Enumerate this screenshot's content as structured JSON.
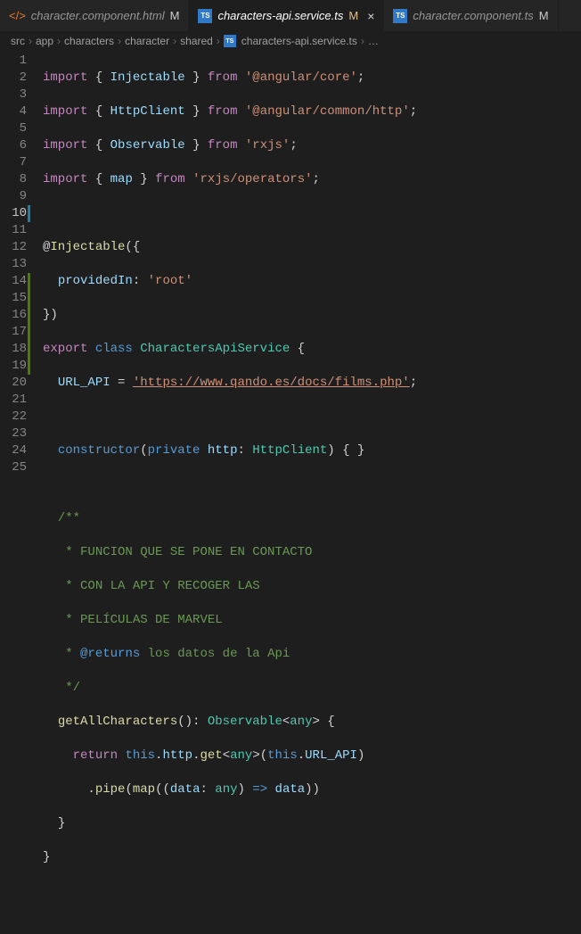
{
  "tabs": [
    {
      "icon": "html",
      "label": "character.component.html",
      "dirty": "M",
      "active": false
    },
    {
      "icon": "ts",
      "label": "characters-api.service.ts",
      "dirty": "M",
      "active": true
    },
    {
      "icon": "ts",
      "label": "character.component.ts",
      "dirty": "M",
      "active": false
    }
  ],
  "breadcrumbs": {
    "parts": [
      "src",
      "app",
      "characters",
      "character",
      "shared"
    ],
    "file_icon": "ts",
    "file": "characters-api.service.ts",
    "trailing": "…"
  },
  "gutter": {
    "highlight_line": 10,
    "decorations": {
      "10": "blue",
      "14": "green",
      "15": "green",
      "16": "green",
      "17": "green",
      "18": "green",
      "19": "green"
    },
    "count": 25
  },
  "code": {
    "l1": {
      "a": "import",
      "b": "Injectable",
      "c": "from",
      "d": "'@angular/core'"
    },
    "l2": {
      "a": "import",
      "b": "HttpClient",
      "c": "from",
      "d": "'@angular/common/http'"
    },
    "l3": {
      "a": "import",
      "b": "Observable",
      "c": "from",
      "d": "'rxjs'"
    },
    "l4": {
      "a": "import",
      "b": "map",
      "c": "from",
      "d": "'rxjs/operators'"
    },
    "l6": {
      "a": "@",
      "b": "Injectable",
      "c": "({"
    },
    "l7": {
      "a": "providedIn",
      "b": ": ",
      "c": "'root'"
    },
    "l8": {
      "a": "})"
    },
    "l9": {
      "a": "export",
      "b": "class",
      "c": "CharactersApiService",
      "d": " {"
    },
    "l10": {
      "a": "URL_API",
      "b": " = ",
      "c": "'https://www.qando.es/docs/films.php'",
      "d": ";"
    },
    "l12": {
      "a": "constructor",
      "b": "(",
      "c": "private",
      "d": "http",
      "e": ": ",
      "f": "HttpClient",
      "g": ") { }"
    },
    "l14": {
      "a": "/**"
    },
    "l15": {
      "a": " * FUNCION QUE SE PONE EN CONTACTO"
    },
    "l16": {
      "a": " * CON LA API Y RECOGER LAS"
    },
    "l17": {
      "a": " * PELÍCULAS DE MARVEL"
    },
    "l18": {
      "a": " * ",
      "b": "@returns",
      "c": " los datos de la Api"
    },
    "l19": {
      "a": " */"
    },
    "l20": {
      "a": "getAllCharacters",
      "b": "(): ",
      "c": "Observable",
      "d": "<",
      "e": "any",
      "f": "> {"
    },
    "l21": {
      "a": "return",
      "b": "this",
      "c": ".",
      "d": "http",
      "e": ".",
      "f": "get",
      "g": "<",
      "h": "any",
      "i": ">(",
      "j": "this",
      "k": ".",
      "l": "URL_API",
      "m": ")"
    },
    "l22": {
      "a": ".",
      "b": "pipe",
      "c": "(",
      "d": "map",
      "e": "((",
      "f": "data",
      "g": ": ",
      "h": "any",
      "i": ") ",
      "j": "=>",
      "k": " ",
      "l": "data",
      "m": "))"
    },
    "l23": {
      "a": "}"
    },
    "l24": {
      "a": "}"
    }
  }
}
